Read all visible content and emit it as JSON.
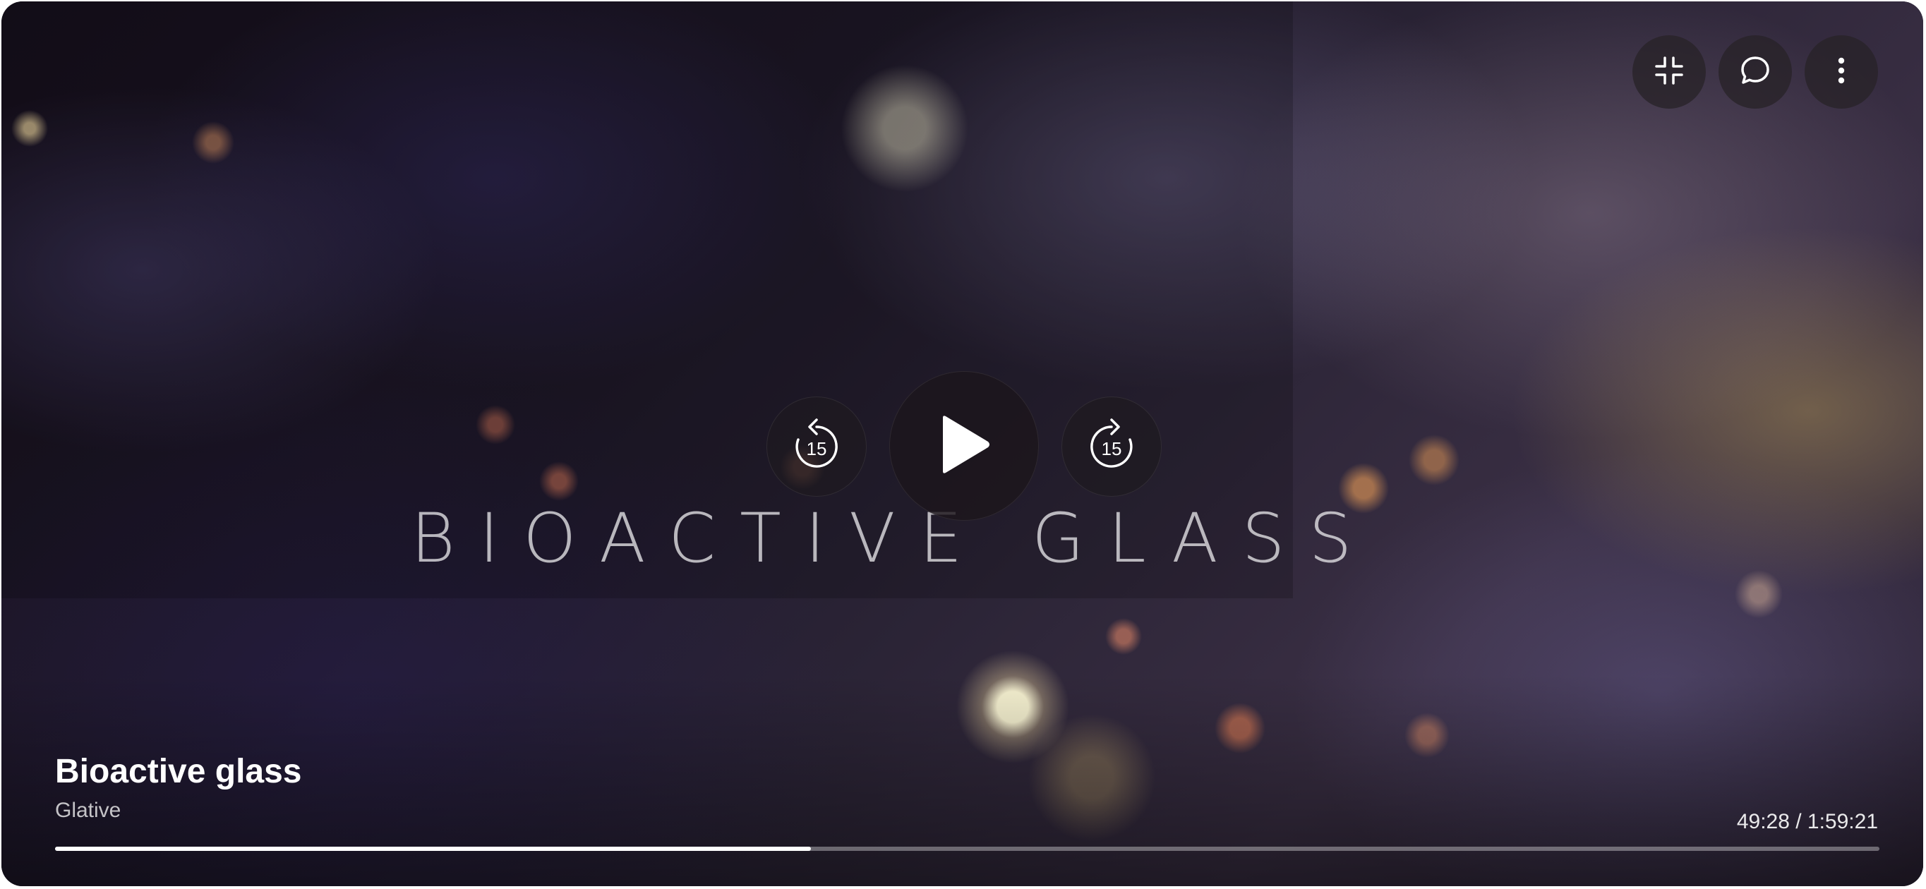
{
  "video": {
    "title": "Bioactive glass",
    "channel": "Glative",
    "title_card_text": "BIOACTIVE GLASS",
    "current_time": "49:28",
    "duration": "1:59:21",
    "time_display": "49:28 / 1:59:21",
    "progress_fraction": 0.4143
  },
  "controls": {
    "skip_back_seconds": "15",
    "skip_forward_seconds": "15",
    "icons": {
      "exit_fullscreen": "exit-fullscreen-icon",
      "comments": "chat-bubble-icon",
      "more": "more-vert-icon",
      "play": "play-icon",
      "replay": "replay-15-icon",
      "forward": "forward-15-icon"
    }
  },
  "colors": {
    "text_primary": "#ffffff",
    "progress_fill": "#ffffff"
  }
}
